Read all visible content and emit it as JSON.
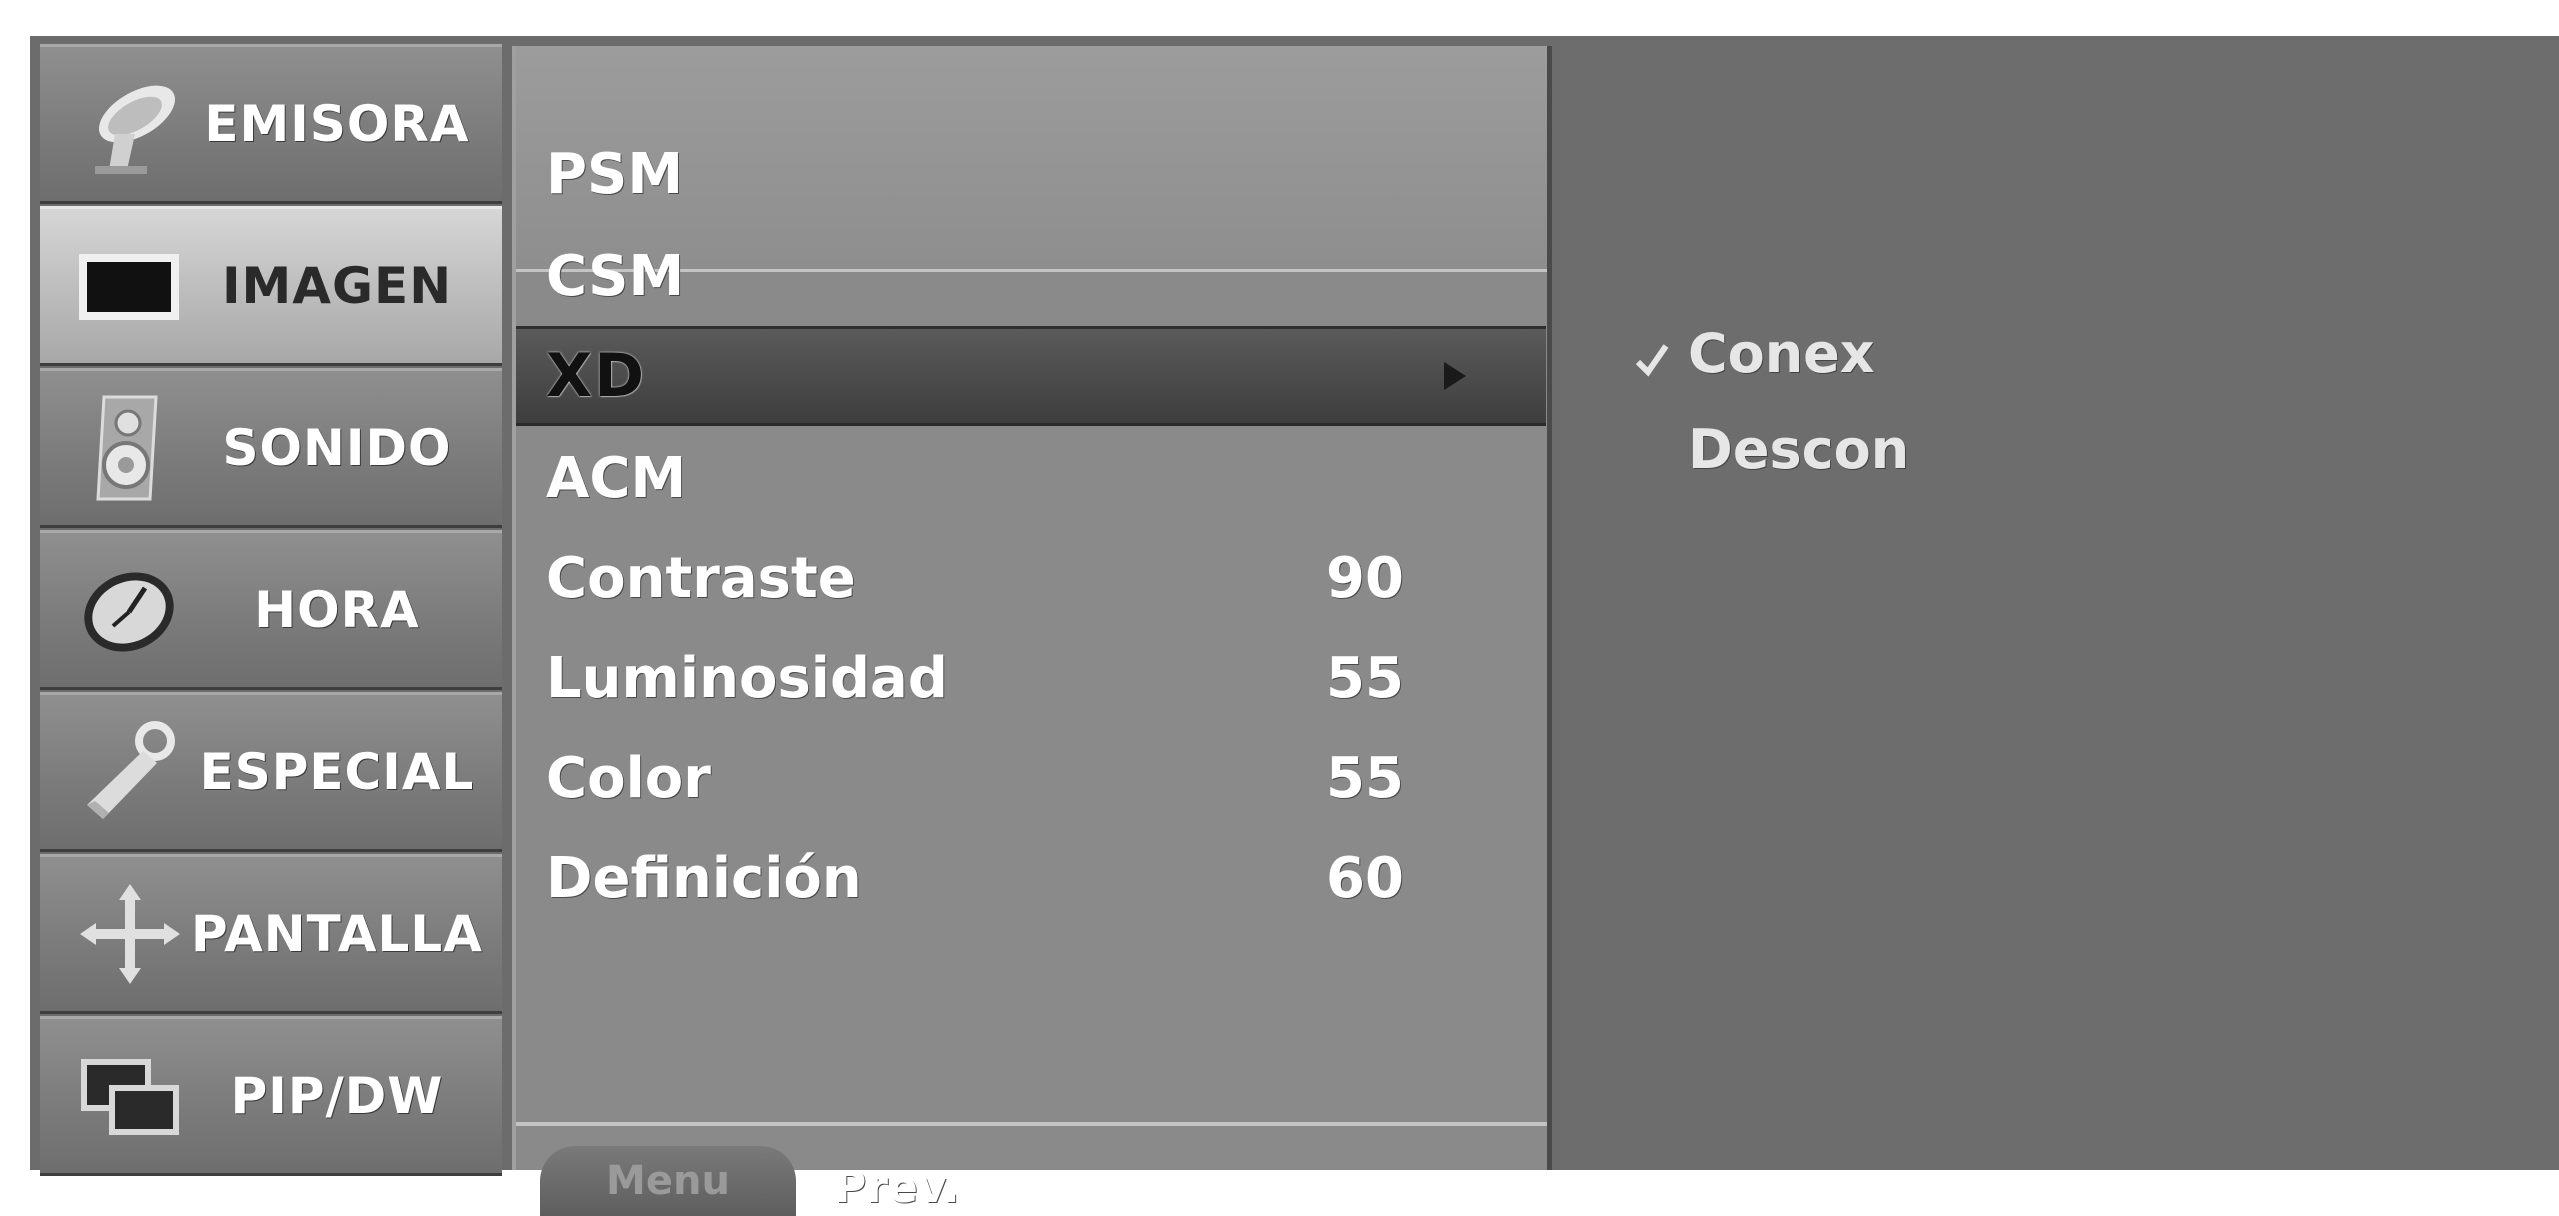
{
  "sidebar": {
    "items": [
      {
        "label": "EMISORA",
        "icon": "satellite-dish-icon",
        "active": false
      },
      {
        "label": "IMAGEN",
        "icon": "screen-icon",
        "active": true
      },
      {
        "label": "SONIDO",
        "icon": "speaker-icon",
        "active": false
      },
      {
        "label": "HORA",
        "icon": "clock-icon",
        "active": false
      },
      {
        "label": "ESPECIAL",
        "icon": "key-icon",
        "active": false
      },
      {
        "label": "PANTALLA",
        "icon": "arrows-icon",
        "active": false
      },
      {
        "label": "PIP/DW",
        "icon": "pip-icon",
        "active": false
      }
    ]
  },
  "menu": {
    "items": [
      {
        "label": "PSM",
        "value": ""
      },
      {
        "label": "CSM",
        "value": ""
      },
      {
        "label": "XD",
        "value": "",
        "selected": true
      },
      {
        "label": "ACM",
        "value": ""
      },
      {
        "label": "Contraste",
        "value": "90"
      },
      {
        "label": "Luminosidad",
        "value": "55"
      },
      {
        "label": "Color",
        "value": "55"
      },
      {
        "label": "Definición",
        "value": "60"
      }
    ],
    "footer": {
      "menu_button": "Menu",
      "prev_label": "Prev."
    }
  },
  "options": {
    "items": [
      {
        "label": "Conex",
        "checked": true
      },
      {
        "label": "Descon",
        "checked": false
      }
    ]
  },
  "colors": {
    "background": "#6c6c6c",
    "active_tab": "#bcbcbc",
    "selected_row": "#4a4a4a",
    "text": "#ffffff"
  }
}
